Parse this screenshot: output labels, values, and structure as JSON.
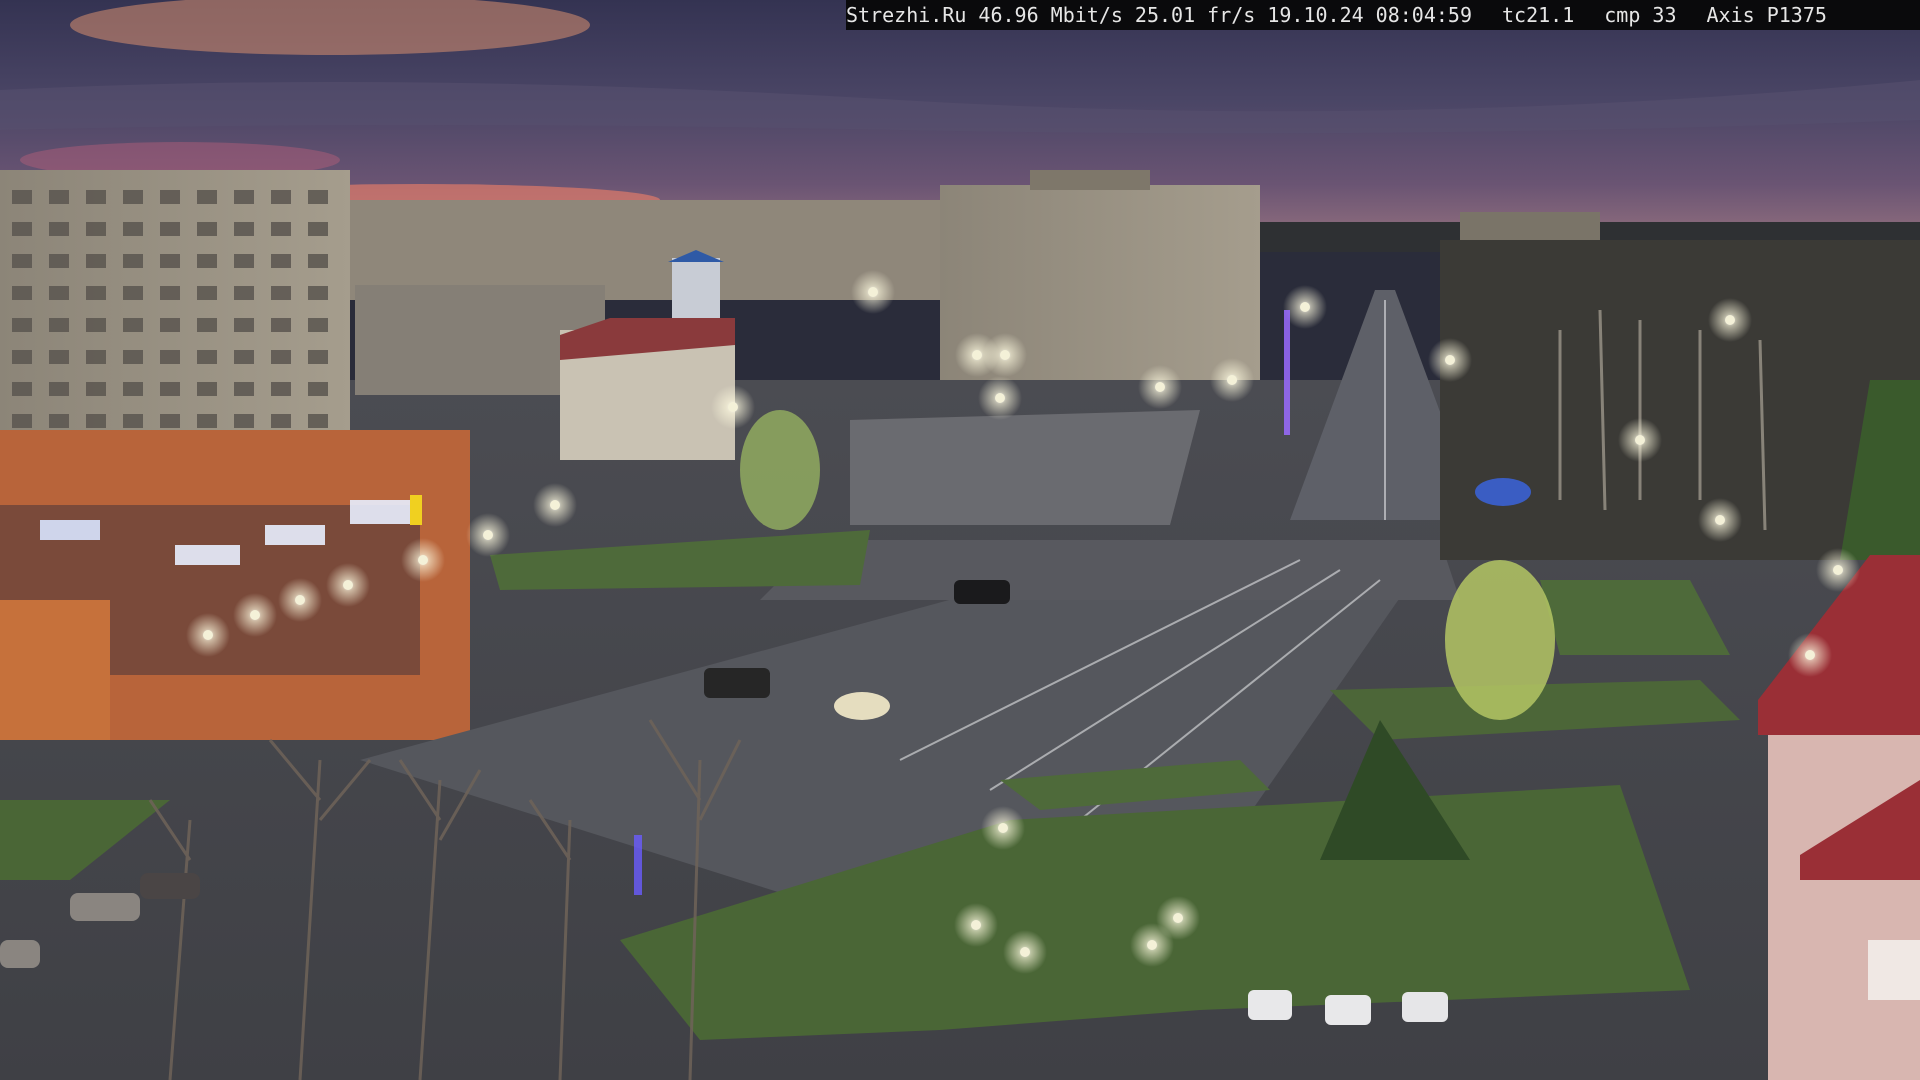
{
  "overlay": {
    "site": "Strezhi.Ru",
    "bitrate": "46.96 Mbit/s",
    "framerate": "25.01 fr/s",
    "date": "19.10.24",
    "time": "08:04:59",
    "tc": "tc21.1",
    "cmp": "cmp 33",
    "camera": "Axis P1375"
  },
  "scene": {
    "description_icon": "city-street-webcam-view",
    "sky_color_top": "#3b3a5a",
    "sky_color_horizon": "#c96a6a",
    "street_light_color": "#f4f1d8",
    "grass_color": "#4e6a3a",
    "road_color": "#5a5c62",
    "building_color": "#a9a08e",
    "roof_color": "#9a2f36"
  }
}
